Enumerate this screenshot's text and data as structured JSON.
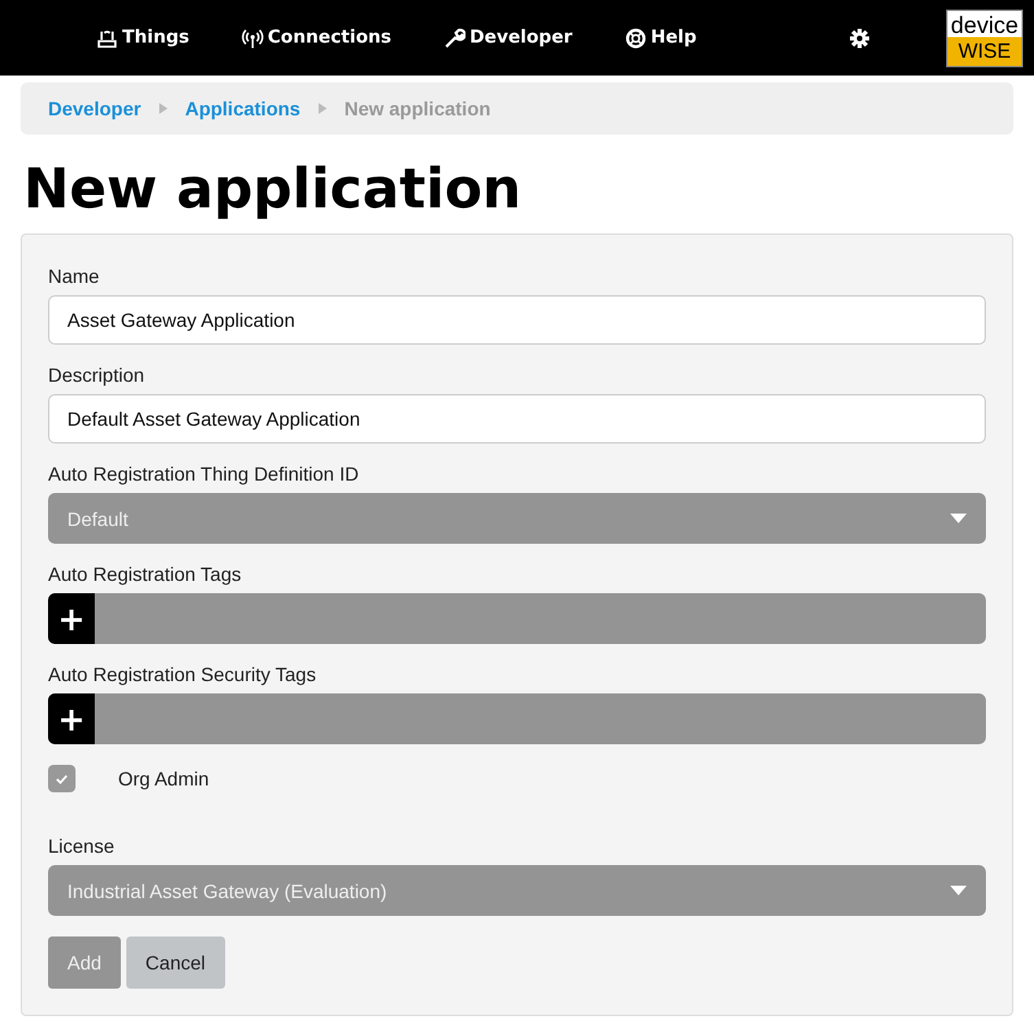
{
  "nav": {
    "items": [
      {
        "label": "Things"
      },
      {
        "label": "Connections"
      },
      {
        "label": "Developer"
      },
      {
        "label": "Help"
      }
    ],
    "logo": {
      "top": "device",
      "bottom": "WISE"
    }
  },
  "breadcrumb": [
    {
      "label": "Developer",
      "current": false
    },
    {
      "label": "Applications",
      "current": false
    },
    {
      "label": "New application",
      "current": true
    }
  ],
  "title": "New application",
  "fields": [
    {
      "kind": "text",
      "label": "Name",
      "value": "Asset Gateway Application"
    },
    {
      "kind": "text",
      "label": "Description",
      "value": "Default Asset Gateway Application"
    },
    {
      "kind": "select",
      "label": "Auto Registration Thing Definition ID",
      "value": "Default"
    },
    {
      "kind": "tags",
      "label": "Auto Registration Tags",
      "button": "+"
    },
    {
      "kind": "tags",
      "label": "Auto Registration Security Tags",
      "button": "+"
    },
    {
      "kind": "checkbox",
      "label": "Org Admin",
      "checked": true
    },
    {
      "kind": "select",
      "label": "License",
      "value": "Industrial Asset Gateway (Evaluation)"
    }
  ],
  "buttons": [
    {
      "label": "Add",
      "kind": "primary"
    },
    {
      "label": "Cancel",
      "kind": "secondary"
    }
  ]
}
